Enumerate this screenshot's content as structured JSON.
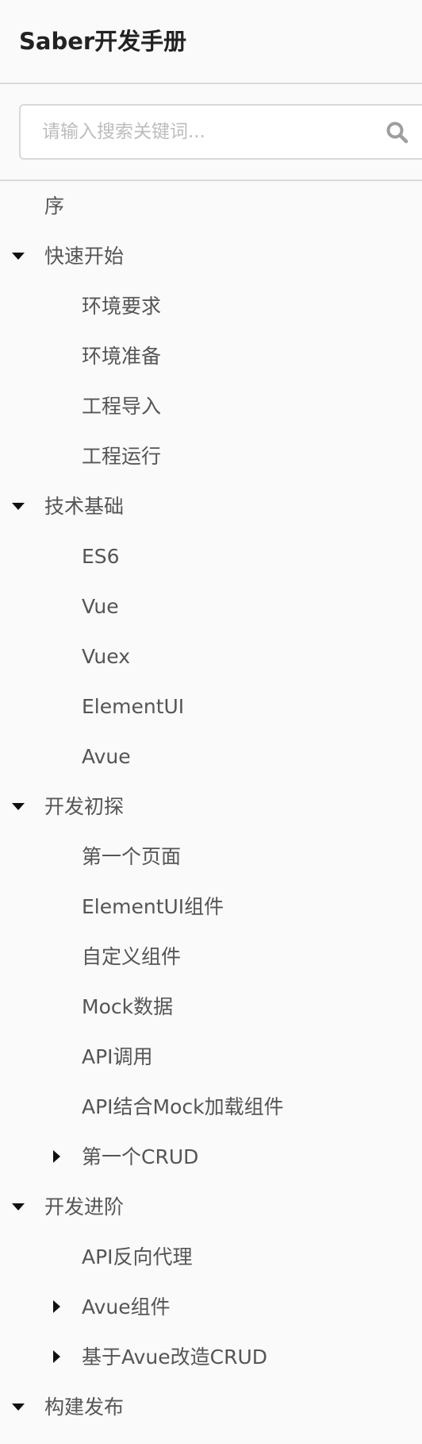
{
  "app": {
    "title": "Saber开发手册"
  },
  "search": {
    "placeholder": "请输入搜索关键词...",
    "value": "",
    "icon": "search-icon"
  },
  "colors": {
    "background": "#fafafa",
    "border": "#d9d9d9",
    "text": "#555555",
    "title": "#222222",
    "placeholder": "#bdbdbd",
    "caret": "#111111",
    "search_icon": "#9e9e9e"
  },
  "nav": {
    "items": [
      {
        "label": "序",
        "level": 1,
        "toggle": "none"
      },
      {
        "label": "快速开始",
        "level": 1,
        "toggle": "expanded"
      },
      {
        "label": "环境要求",
        "level": 2,
        "toggle": "none"
      },
      {
        "label": "环境准备",
        "level": 2,
        "toggle": "none"
      },
      {
        "label": "工程导入",
        "level": 2,
        "toggle": "none"
      },
      {
        "label": "工程运行",
        "level": 2,
        "toggle": "none"
      },
      {
        "label": "技术基础",
        "level": 1,
        "toggle": "expanded"
      },
      {
        "label": "ES6",
        "level": 2,
        "toggle": "none"
      },
      {
        "label": "Vue",
        "level": 2,
        "toggle": "none"
      },
      {
        "label": "Vuex",
        "level": 2,
        "toggle": "none"
      },
      {
        "label": "ElementUI",
        "level": 2,
        "toggle": "none"
      },
      {
        "label": "Avue",
        "level": 2,
        "toggle": "none"
      },
      {
        "label": "开发初探",
        "level": 1,
        "toggle": "expanded"
      },
      {
        "label": "第一个页面",
        "level": 2,
        "toggle": "none"
      },
      {
        "label": "ElementUI组件",
        "level": 2,
        "toggle": "none"
      },
      {
        "label": "自定义组件",
        "level": 2,
        "toggle": "none"
      },
      {
        "label": "Mock数据",
        "level": 2,
        "toggle": "none"
      },
      {
        "label": "API调用",
        "level": 2,
        "toggle": "none"
      },
      {
        "label": "API结合Mock加载组件",
        "level": 2,
        "toggle": "none"
      },
      {
        "label": "第一个CRUD",
        "level": 2,
        "toggle": "collapsed"
      },
      {
        "label": "开发进阶",
        "level": 1,
        "toggle": "expanded"
      },
      {
        "label": "API反向代理",
        "level": 2,
        "toggle": "none"
      },
      {
        "label": "Avue组件",
        "level": 2,
        "toggle": "collapsed"
      },
      {
        "label": "基于Avue改造CRUD",
        "level": 2,
        "toggle": "collapsed"
      },
      {
        "label": "构建发布",
        "level": 1,
        "toggle": "expanded"
      }
    ]
  }
}
